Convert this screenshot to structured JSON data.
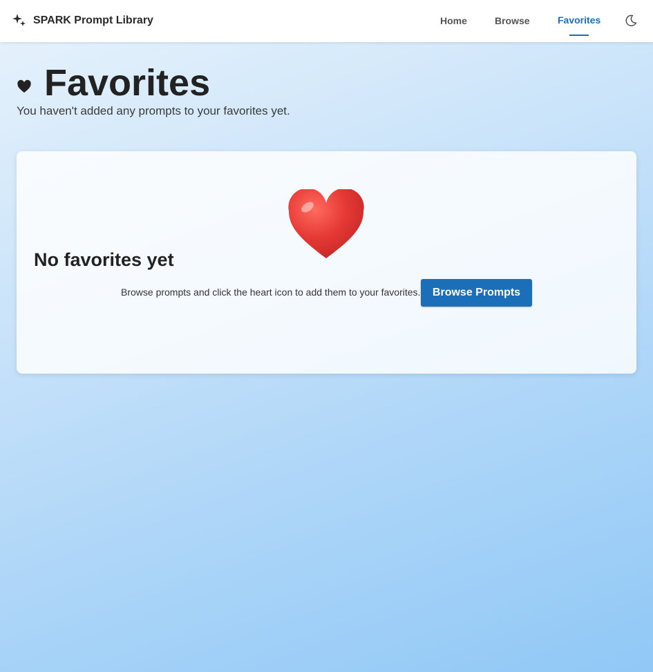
{
  "app": {
    "title": "SPARK Prompt Library"
  },
  "nav": {
    "home": "Home",
    "browse": "Browse",
    "favorites": "Favorites",
    "active": "Favorites"
  },
  "header": {
    "title": "Favorites",
    "subtitle": "You haven't added any prompts to your favorites yet."
  },
  "empty_state": {
    "title": "No favorites yet",
    "message": "Browse prompts and click the heart icon to add them to your favorites.",
    "button_label": "Browse Prompts"
  },
  "icons": {
    "brand": "sparkles-icon",
    "theme": "moon-icon",
    "header": "heart-icon",
    "empty": "heart-icon"
  },
  "colors": {
    "accent": "#1a6fb8",
    "heart": "#e53935"
  }
}
